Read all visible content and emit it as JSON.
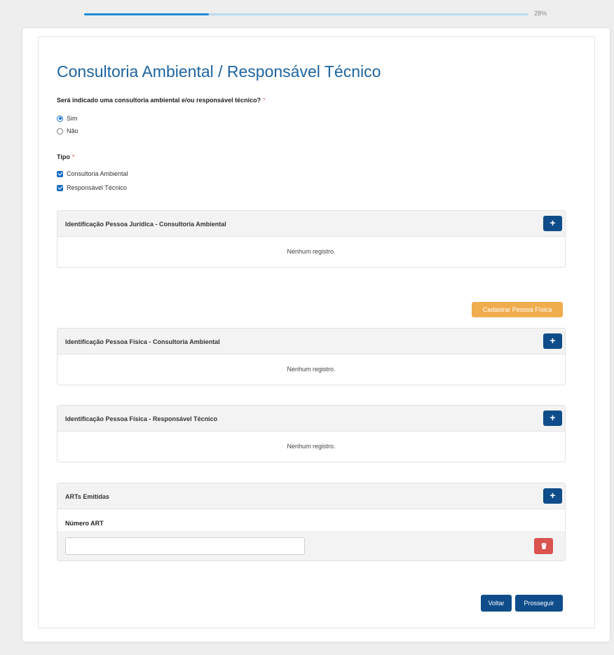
{
  "progress": {
    "value": 0.28,
    "label": "28%"
  },
  "form": {
    "title": "Consultoria Ambiental / Responsável Técnico",
    "question": {
      "label": "Será indicado uma consultoria ambiental e/ou responsável técnico?",
      "required_mark": "*",
      "options": [
        {
          "label": "Sim",
          "selected": true
        },
        {
          "label": "Não",
          "selected": false
        }
      ]
    },
    "tipo": {
      "label": "Tipo",
      "required_mark": "*",
      "options": [
        {
          "label": "Consultoria Ambiental",
          "checked": true
        },
        {
          "label": "Responsável Técnico",
          "checked": true
        }
      ]
    },
    "panels": [
      {
        "title": "Identificação Pessoa Jurídica - Consultoria Ambiental",
        "empty_text": "Nenhum registro.",
        "add_icon": "+"
      },
      {
        "title": "Identificação Pessoa Física - Consultoria Ambiental",
        "empty_text": "Nenhum registro.",
        "add_icon": "+"
      },
      {
        "title": "Identificação Pessoa Física - Responsável Técnico",
        "empty_text": "Nenhum registro.",
        "add_icon": "+"
      }
    ],
    "cadastrar_button": "Cadastrar Pessoa Física",
    "arts": {
      "title": "ARTs Emitidas",
      "add_icon": "+",
      "column_header": "Número ART",
      "rows": [
        {
          "numero": ""
        }
      ]
    },
    "buttons": {
      "back": "Voltar",
      "next": "Prosseguir"
    }
  },
  "colors": {
    "title": "#1e64a0",
    "primary_button": "#0f4d8a",
    "warning_button": "#f0ad4e",
    "danger_button": "#d9534f",
    "progress_fill": "#1b8ad8"
  }
}
